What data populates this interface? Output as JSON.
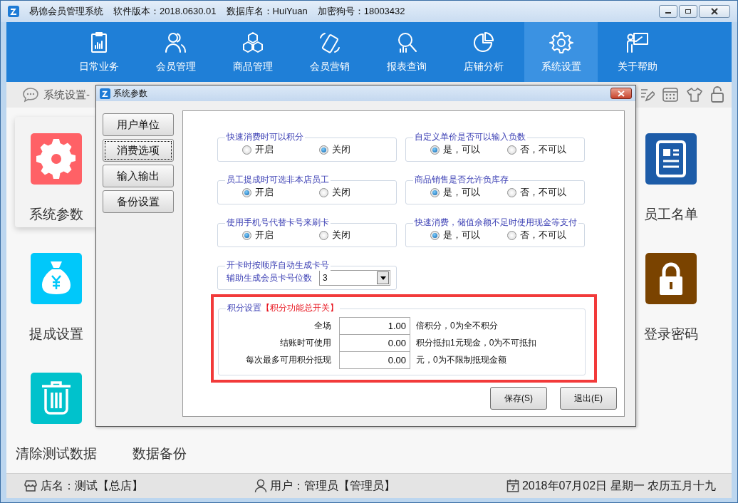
{
  "window": {
    "app_name": "易德会员管理系统",
    "version": "软件版本：2018.0630.01",
    "database": "数据库名：HuiYuan",
    "dongle": "加密狗号：18003432"
  },
  "nav": [
    {
      "label": "日常业务",
      "selected": false
    },
    {
      "label": "会员管理",
      "selected": false
    },
    {
      "label": "商品管理",
      "selected": false
    },
    {
      "label": "会员营销",
      "selected": false
    },
    {
      "label": "报表查询",
      "selected": false
    },
    {
      "label": "店铺分析",
      "selected": false
    },
    {
      "label": "系统设置",
      "selected": true
    },
    {
      "label": "关于帮助",
      "selected": false
    }
  ],
  "breadcrumb": "系统设置-",
  "tiles": [
    {
      "label": "系统参数",
      "color": "#ff6166",
      "selected": true
    },
    {
      "label": "员工名单",
      "color": "#1d5ca8",
      "selected": false
    },
    {
      "label": "提成设置",
      "color": "#00c8fa",
      "selected": false
    },
    {
      "label": "登录密码",
      "color": "#7a4300",
      "selected": false
    },
    {
      "label": "清除测试数据",
      "color": "#00c2cc",
      "selected": false
    },
    {
      "label": "数据备份",
      "selected": false
    }
  ],
  "status_bar": {
    "shop": "店名：测试【总店】",
    "user": "用户：管理员【管理员】",
    "date": "2018年07月02日 星期一 农历五月十九"
  },
  "dialog": {
    "title": "系统参数",
    "tabs": [
      {
        "label": "用户单位",
        "selected": false
      },
      {
        "label": "消费选项",
        "selected": true
      },
      {
        "label": "输入输出",
        "selected": false
      },
      {
        "label": "备份设置",
        "selected": false
      }
    ],
    "groups": [
      {
        "kind": "radio",
        "title": "快速消费时可以积分",
        "options": [
          {
            "label": "开启",
            "selected": false
          },
          {
            "label": "关闭",
            "selected": true
          }
        ]
      },
      {
        "kind": "radio",
        "title": "自定义单价是否可以输入负数",
        "options": [
          {
            "label": "是，可以",
            "selected": true
          },
          {
            "label": "否，不可以",
            "selected": false
          }
        ]
      },
      {
        "kind": "radio",
        "title": "员工提成时可选非本店员工",
        "options": [
          {
            "label": "开启",
            "selected": true
          },
          {
            "label": "关闭",
            "selected": false
          }
        ]
      },
      {
        "kind": "radio",
        "title": "商品销售是否允许负库存",
        "options": [
          {
            "label": "是，可以",
            "selected": true
          },
          {
            "label": "否，不可以",
            "selected": false
          }
        ]
      },
      {
        "kind": "radio",
        "title": "使用手机号代替卡号来刷卡",
        "options": [
          {
            "label": "开启",
            "selected": true
          },
          {
            "label": "关闭",
            "selected": false
          }
        ]
      },
      {
        "kind": "radio",
        "title": "快速消费，储值余额不足时使用现金等支付",
        "options": [
          {
            "label": "是，可以",
            "selected": true
          },
          {
            "label": "否，不可以",
            "selected": false
          }
        ]
      },
      {
        "kind": "dropdown",
        "title": "开卡时按顺序自动生成卡号",
        "label": "辅助生成会员卡号位数",
        "value": "3"
      }
    ],
    "points": {
      "title": "积分设置",
      "title_note": "【积分功能总开关】",
      "highlighted": true,
      "rows": [
        {
          "label": "全场",
          "value": "1.00",
          "note": "倍积分，0为全不积分"
        },
        {
          "label": "结账时可使用",
          "value": "0.00",
          "note": "积分抵扣1元现金，0为不可抵扣"
        },
        {
          "label": "每次最多可用积分抵现",
          "value": "0.00",
          "note": "元，0为不限制抵现金额"
        }
      ]
    },
    "buttons": [
      {
        "label": "保存(S)"
      },
      {
        "label": "退出(E)"
      }
    ]
  }
}
